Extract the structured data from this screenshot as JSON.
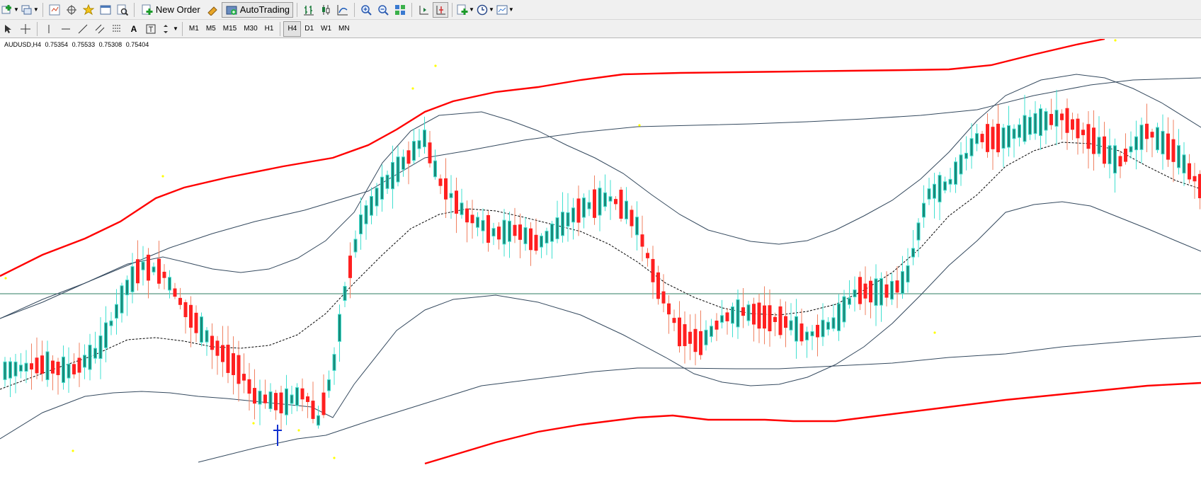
{
  "toolbar": {
    "new_order_label": "New Order",
    "autotrading_label": "AutoTrading",
    "buttons_row1": [
      "new-chart-icon",
      "profiles-icon",
      "market-watch-icon",
      "navigator-icon",
      "data-window-icon",
      "strategy-tester-icon",
      "new-order-icon",
      "metaeditor-icon",
      "autotrading-icon",
      "bar-chart-icon",
      "candlesticks-icon",
      "line-chart-icon",
      "zoom-in-icon",
      "zoom-out-icon",
      "tile-windows-icon",
      "chart-shift-icon",
      "autoscroll-icon",
      "indicators-icon",
      "periodicity-icon",
      "templates-icon"
    ],
    "buttons_row2": [
      "cursor-icon",
      "crosshair-icon",
      "vertical-line-icon",
      "horizontal-line-icon",
      "trendline-icon",
      "equidistant-channel-icon",
      "fibonacci-icon",
      "text-icon",
      "text-label-icon",
      "arrows-icon"
    ],
    "periods": [
      "M1",
      "M5",
      "M15",
      "M30",
      "H1",
      "H4",
      "D1",
      "W1",
      "MN"
    ],
    "active_period": "H4"
  },
  "chart": {
    "symbol": "AUDUSD,H4",
    "open": "0.75354",
    "high": "0.75533",
    "low": "0.75308",
    "close": "0.75404",
    "colors": {
      "bull": "#40e0d0",
      "bear": "#ff2020",
      "bear_wick": "#f08060",
      "envelope": "#ff0000",
      "band": "#34495e",
      "ma": "#000000",
      "hline": "#2e7d62",
      "dot": "#ffff00"
    }
  },
  "chart_data": {
    "type": "candlestick",
    "symbol": "AUDUSD",
    "timeframe": "H4",
    "last_bar": {
      "open": 0.75354,
      "high": 0.75533,
      "low": 0.75308,
      "close": 0.75404
    },
    "indicators": [
      "Bollinger Bands (upper, middle dashed, lower)",
      "Envelopes (red)",
      "Bollinger Bands wide (upper, lower)",
      "Horizontal line"
    ],
    "candles_count": 120
  }
}
